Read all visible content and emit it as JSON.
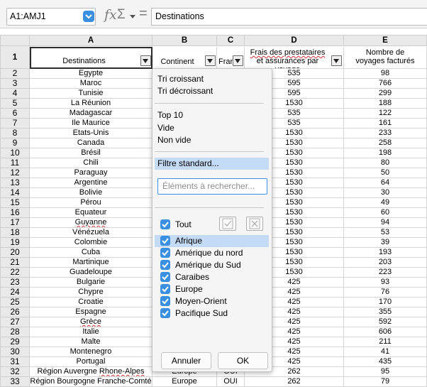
{
  "formula_bar": {
    "name_box": "A1:AMJ1",
    "fx": "fx",
    "sigma": "Σ",
    "equals": "=",
    "content": "Destinations"
  },
  "columns": [
    "A",
    "B",
    "C",
    "D",
    "E"
  ],
  "header_row": {
    "row_number": "1",
    "a": "Destinations",
    "b": "Continent",
    "c": "Fran",
    "d_line1": "Frais des prestataires",
    "d_line2": "et assurances par voyage",
    "e_line1": "Nombre de",
    "e_line2": "voyages facturés"
  },
  "rows": [
    {
      "n": "2",
      "a": "Egypte",
      "b": "",
      "c": "",
      "d": "535",
      "e": "98"
    },
    {
      "n": "3",
      "a": "Maroc",
      "b": "",
      "c": "",
      "d": "595",
      "e": "766"
    },
    {
      "n": "4",
      "a": "Tunisie",
      "b": "",
      "c": "",
      "d": "595",
      "e": "299"
    },
    {
      "n": "5",
      "a": "La Réunion",
      "b": "",
      "c": "",
      "d": "1530",
      "e": "188"
    },
    {
      "n": "6",
      "a": "Madagascar",
      "b": "",
      "c": "",
      "d": "535",
      "e": "122"
    },
    {
      "n": "7",
      "a": "Ile Maurice",
      "b": "",
      "c": "",
      "d": "535",
      "e": "161"
    },
    {
      "n": "8",
      "a": "Etats-Unis",
      "b": "",
      "c": "",
      "d": "1530",
      "e": "233"
    },
    {
      "n": "9",
      "a": "Canada",
      "b": "",
      "c": "",
      "d": "1530",
      "e": "258"
    },
    {
      "n": "10",
      "a": "Brésil",
      "b": "",
      "c": "",
      "d": "1530",
      "e": "198"
    },
    {
      "n": "11",
      "a": "Chili",
      "b": "",
      "c": "",
      "d": "1530",
      "e": "80"
    },
    {
      "n": "12",
      "a": "Paraguay",
      "b": "",
      "c": "",
      "d": "1530",
      "e": "50"
    },
    {
      "n": "13",
      "a": "Argentine",
      "b": "",
      "c": "",
      "d": "1530",
      "e": "64"
    },
    {
      "n": "14",
      "a": "Bolivie",
      "b": "",
      "c": "",
      "d": "1530",
      "e": "30"
    },
    {
      "n": "15",
      "a": "Pérou",
      "b": "",
      "c": "",
      "d": "1530",
      "e": "49"
    },
    {
      "n": "16",
      "a": "Equateur",
      "b": "",
      "c": "",
      "d": "1530",
      "e": "60"
    },
    {
      "n": "17",
      "a": "Guyanne",
      "b": "",
      "c": "",
      "d": "1530",
      "e": "94"
    },
    {
      "n": "18",
      "a": "Vénézuela",
      "b": "",
      "c": "",
      "d": "1530",
      "e": "53"
    },
    {
      "n": "19",
      "a": "Colombie",
      "b": "",
      "c": "",
      "d": "1530",
      "e": "39"
    },
    {
      "n": "20",
      "a": "Cuba",
      "b": "",
      "c": "",
      "d": "1530",
      "e": "193"
    },
    {
      "n": "21",
      "a": "Martinique",
      "b": "",
      "c": "",
      "d": "1530",
      "e": "203"
    },
    {
      "n": "22",
      "a": "Guadeloupe",
      "b": "",
      "c": "",
      "d": "1530",
      "e": "223"
    },
    {
      "n": "23",
      "a": "Bulgarie",
      "b": "",
      "c": "",
      "d": "425",
      "e": "93"
    },
    {
      "n": "24",
      "a": "Chypre",
      "b": "",
      "c": "",
      "d": "425",
      "e": "76"
    },
    {
      "n": "25",
      "a": "Croatie",
      "b": "",
      "c": "",
      "d": "425",
      "e": "170"
    },
    {
      "n": "26",
      "a": "Espagne",
      "b": "",
      "c": "",
      "d": "425",
      "e": "355"
    },
    {
      "n": "27",
      "a": "Grèce",
      "b": "",
      "c": "",
      "d": "425",
      "e": "592"
    },
    {
      "n": "28",
      "a": "Italie",
      "b": "",
      "c": "",
      "d": "425",
      "e": "606"
    },
    {
      "n": "29",
      "a": "Malte",
      "b": "",
      "c": "",
      "d": "425",
      "e": "211"
    },
    {
      "n": "30",
      "a": "Montenegro",
      "b": "",
      "c": "",
      "d": "425",
      "e": "41"
    },
    {
      "n": "31",
      "a": "Portugal",
      "b": "",
      "c": "",
      "d": "425",
      "e": "435"
    },
    {
      "n": "32",
      "a": "Région Auvergne Rhone-Alpes",
      "b": "Europe",
      "c": "OUI",
      "d": "262",
      "e": "95"
    },
    {
      "n": "33",
      "a": "Région Bourgogne Franche-Comté",
      "b": "Europe",
      "c": "OUI",
      "d": "262",
      "e": "79"
    }
  ],
  "spell_errors": [
    "Guyanne",
    "Grèce",
    "Rhone-Alpes"
  ],
  "popup": {
    "sort_asc": "Tri croissant",
    "sort_desc": "Tri décroissant",
    "top10": "Top 10",
    "empty": "Vide",
    "not_empty": "Non vide",
    "standard_filter": "Filtre standard...",
    "search_placeholder": "Éléments à rechercher...",
    "all": "Tout",
    "values": [
      "Afrique",
      "Amérique du nord",
      "Amérique du Sud",
      "Caraibes",
      "Europe",
      "Moyen-Orient",
      "Pacifique Sud"
    ],
    "cancel": "Annuler",
    "ok": "OK"
  },
  "colors": {
    "accent": "#3b8fe0",
    "selection": "#c4dbf6",
    "header_bg": "#e9e9e9",
    "popup_bg": "#f5f5f5"
  }
}
